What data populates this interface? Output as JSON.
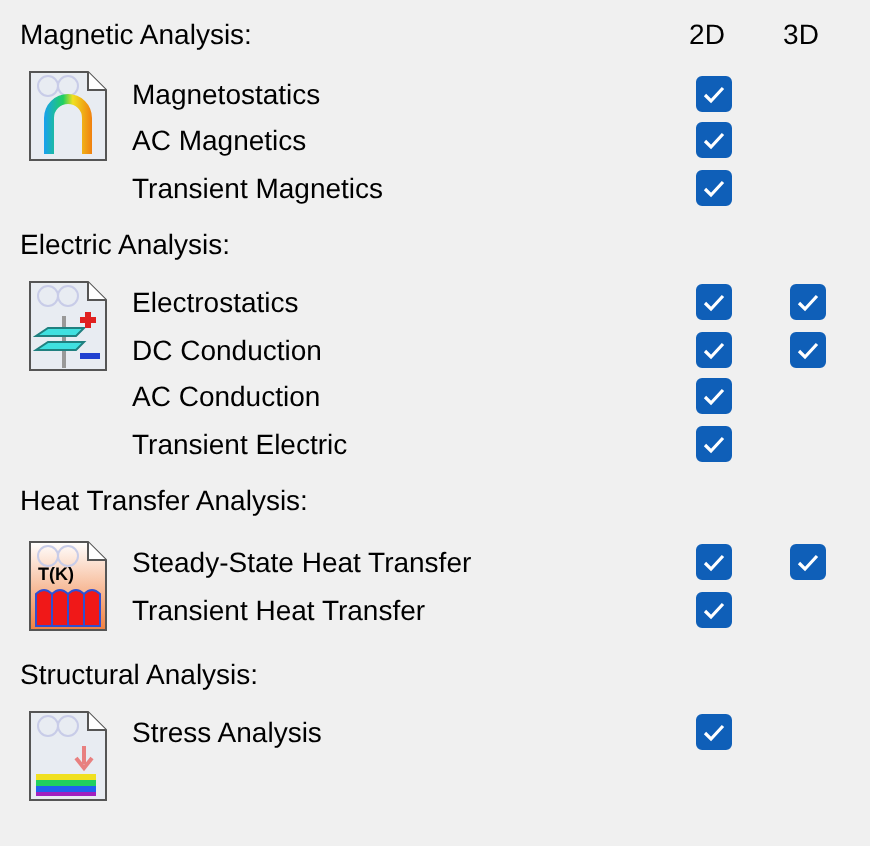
{
  "columns": [
    "2D",
    "3D"
  ],
  "groups": [
    {
      "title": "Magnetic Analysis:",
      "kind": "magnet",
      "items": [
        {
          "label": "Magnetostatics",
          "checked_2d": true
        },
        {
          "label": "AC Magnetics",
          "checked_2d": true
        },
        {
          "label": "Transient Magnetics",
          "checked_2d": true
        }
      ]
    },
    {
      "title": "Electric Analysis:",
      "kind": "electric",
      "items": [
        {
          "label": "Electrostatics",
          "checked_2d": true,
          "checked_3d": true
        },
        {
          "label": "DC Conduction",
          "checked_2d": true,
          "checked_3d": true
        },
        {
          "label": "AC Conduction",
          "checked_2d": true
        },
        {
          "label": "Transient Electric",
          "checked_2d": true
        }
      ]
    },
    {
      "title": "Heat Transfer Analysis:",
      "kind": "heat",
      "icon_text": "T(K)",
      "items": [
        {
          "label": "Steady-State Heat Transfer",
          "checked_2d": true,
          "checked_3d": true
        },
        {
          "label": "Transient Heat Transfer",
          "checked_2d": true
        }
      ]
    },
    {
      "title": "Structural Analysis:",
      "kind": "stress",
      "items": [
        {
          "label": "Stress Analysis",
          "checked_2d": true
        }
      ]
    }
  ]
}
